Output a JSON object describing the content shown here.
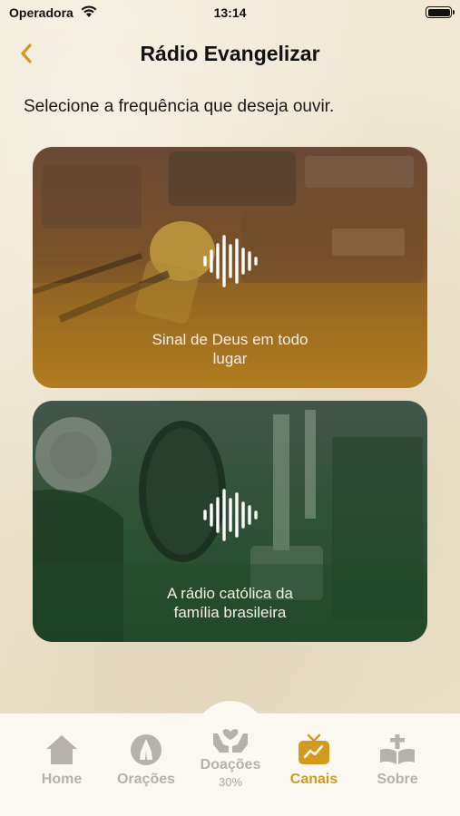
{
  "status_bar": {
    "carrier": "Operadora",
    "time": "13:14"
  },
  "header": {
    "title": "Rádio Evangelizar",
    "back_icon": "chevron-left-icon",
    "accent_color": "#d49a1e"
  },
  "instruction": "Selecione a frequência que deseja ouvir.",
  "frequencies": [
    {
      "caption_line1": "Sinal de Deus em todo",
      "caption_line2": "lugar",
      "tint": "#9a6a22",
      "icon": "sound-wave-icon"
    },
    {
      "caption_line1": "A rádio católica da",
      "caption_line2": "família brasileira",
      "tint": "#2f5236",
      "icon": "sound-wave-icon"
    }
  ],
  "tab_bar": {
    "tabs": [
      {
        "label": "Home",
        "icon": "home-icon"
      },
      {
        "label": "Orações",
        "icon": "praying-hands-icon"
      },
      {
        "label": "Doações",
        "icon": "heart-hands-icon",
        "sublabel": "30%"
      },
      {
        "label": "Canais",
        "icon": "tv-icon",
        "active": true
      },
      {
        "label": "Sobre",
        "icon": "bible-cross-icon"
      }
    ],
    "active_color": "#d49a1e",
    "inactive_color": "#b6b1aa"
  }
}
